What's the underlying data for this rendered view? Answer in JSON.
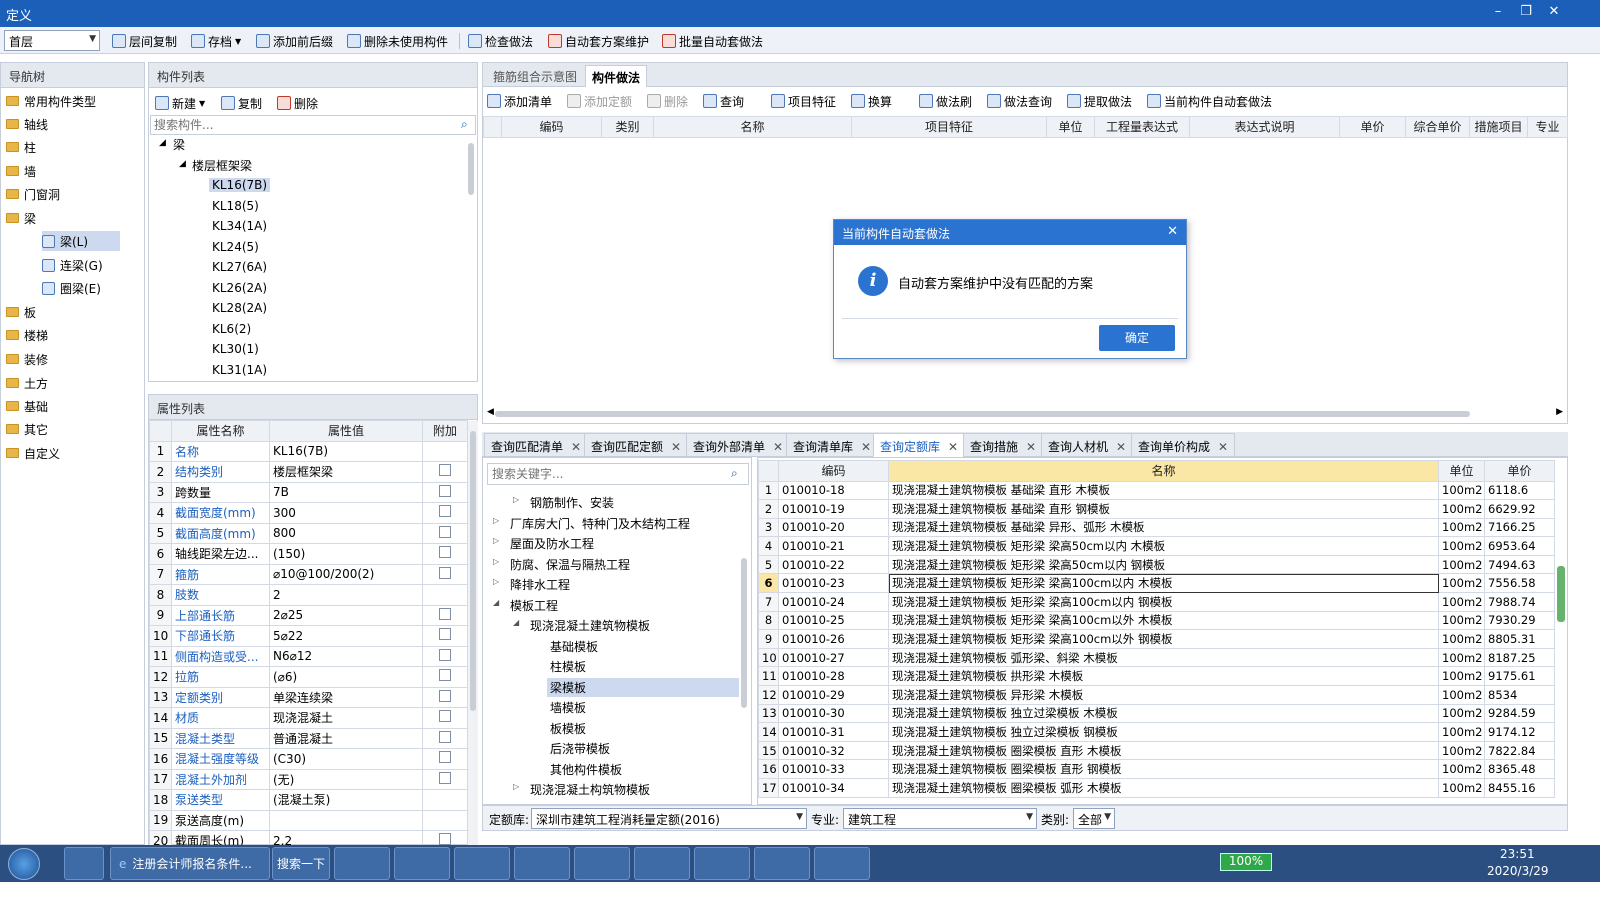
{
  "window": {
    "title": "定义",
    "min": "–",
    "restore": "❐",
    "close": "✕"
  },
  "toolbar": {
    "floor": "首层",
    "buttons": [
      "层间复制",
      "存档",
      "添加前后缀",
      "删除未使用构件",
      "检查做法",
      "自动套方案维护",
      "批量自动套做法"
    ]
  },
  "nav": {
    "title": "导航树",
    "items": [
      "常用构件类型",
      "轴线",
      "柱",
      "墙",
      "门窗洞",
      "梁",
      "梁(L)",
      "连梁(G)",
      "圈梁(E)",
      "板",
      "楼梯",
      "装修",
      "土方",
      "基础",
      "其它",
      "自定义"
    ]
  },
  "complist": {
    "title": "构件列表",
    "new": "新建",
    "copy": "复制",
    "del": "删除",
    "search_ph": "搜索构件...",
    "root": "梁",
    "group": "楼层框架梁",
    "items": [
      "KL16(7B)",
      "KL18(5)",
      "KL34(1A)",
      "KL24(5)",
      "KL27(6A)",
      "KL26(2A)",
      "KL28(2A)",
      "KL6(2)",
      "KL30(1)",
      "KL31(1A)"
    ]
  },
  "props": {
    "title": "属性列表",
    "cols": [
      "属性名称",
      "属性值",
      "附加"
    ],
    "rows": [
      [
        "1",
        "名称",
        "KL16(7B)"
      ],
      [
        "2",
        "结构类别",
        "楼层框架梁"
      ],
      [
        "3",
        "跨数量",
        "7B"
      ],
      [
        "4",
        "截面宽度(mm)",
        "300"
      ],
      [
        "5",
        "截面高度(mm)",
        "800"
      ],
      [
        "6",
        "轴线距梁左边...",
        "(150)"
      ],
      [
        "7",
        "箍筋",
        "⌀10@100/200(2)"
      ],
      [
        "8",
        "肢数",
        "2"
      ],
      [
        "9",
        "上部通长筋",
        "2⌀25"
      ],
      [
        "10",
        "下部通长筋",
        "5⌀22"
      ],
      [
        "11",
        "侧面构造或受...",
        "N6⌀12"
      ],
      [
        "12",
        "拉筋",
        "(⌀6)"
      ],
      [
        "13",
        "定额类别",
        "单梁连续梁"
      ],
      [
        "14",
        "材质",
        "现浇混凝土"
      ],
      [
        "15",
        "混凝土类型",
        "普通混凝土"
      ],
      [
        "16",
        "混凝土强度等级",
        "(C30)"
      ],
      [
        "17",
        "混凝土外加剂",
        "(无)"
      ],
      [
        "18",
        "泵送类型",
        "(混凝土泵)"
      ],
      [
        "19",
        "泵送高度(m)",
        ""
      ],
      [
        "20",
        "截面周长(m)",
        "2.2"
      ]
    ]
  },
  "tabs_top": [
    "箍筋组合示意图",
    "构件做法"
  ],
  "method_toolbar": [
    "添加清单",
    "添加定额",
    "删除",
    "查询",
    "项目特征",
    "换算",
    "做法刷",
    "做法查询",
    "提取做法",
    "当前构件自动套做法"
  ],
  "method_cols": [
    "编码",
    "类别",
    "名称",
    "项目特征",
    "单位",
    "工程量表达式",
    "表达式说明",
    "单价",
    "综合单价",
    "措施项目",
    "专业"
  ],
  "dialog": {
    "title": "当前构件自动套做法",
    "message": "自动套方案维护中没有匹配的方案",
    "ok": "确定",
    "icon": "i"
  },
  "bottom_tabs": [
    "查询匹配清单",
    "查询匹配定额",
    "查询外部清单",
    "查询清单库",
    "查询定额库",
    "查询措施",
    "查询人材机",
    "查询单价构成"
  ],
  "quota_search_ph": "搜索关键字...",
  "quota_tree": [
    "钢筋制作、安装",
    "厂库房大门、特种门及木结构工程",
    "屋面及防水工程",
    "防腐、保温与隔热工程",
    "降排水工程",
    "模板工程",
    "现浇混凝土建筑物模板",
    "基础模板",
    "柱模板",
    "梁模板",
    "墙模板",
    "板模板",
    "后浇带模板",
    "其他构件模板",
    "现浇混凝土构筑物模板"
  ],
  "quota_cols": [
    "编码",
    "名称",
    "单位",
    "单价"
  ],
  "quota_rows": [
    [
      "1",
      "010010-18",
      "现浇混凝土建筑物模板 基础梁 直形 木模板",
      "100m2",
      "6118.6"
    ],
    [
      "2",
      "010010-19",
      "现浇混凝土建筑物模板 基础梁 直形 钢模板",
      "100m2",
      "6629.92"
    ],
    [
      "3",
      "010010-20",
      "现浇混凝土建筑物模板 基础梁 异形、弧形 木模板",
      "100m2",
      "7166.25"
    ],
    [
      "4",
      "010010-21",
      "现浇混凝土建筑物模板 矩形梁 梁高50cm以内 木模板",
      "100m2",
      "6953.64"
    ],
    [
      "5",
      "010010-22",
      "现浇混凝土建筑物模板 矩形梁 梁高50cm以内 钢模板",
      "100m2",
      "7494.63"
    ],
    [
      "6",
      "010010-23",
      "现浇混凝土建筑物模板 矩形梁 梁高100cm以内 木模板",
      "100m2",
      "7556.58"
    ],
    [
      "7",
      "010010-24",
      "现浇混凝土建筑物模板 矩形梁 梁高100cm以内 钢模板",
      "100m2",
      "7988.74"
    ],
    [
      "8",
      "010010-25",
      "现浇混凝土建筑物模板 矩形梁 梁高100cm以外 木模板",
      "100m2",
      "7930.29"
    ],
    [
      "9",
      "010010-26",
      "现浇混凝土建筑物模板 矩形梁 梁高100cm以外 钢模板",
      "100m2",
      "8805.31"
    ],
    [
      "10",
      "010010-27",
      "现浇混凝土建筑物模板 弧形梁、斜梁 木模板",
      "100m2",
      "8187.25"
    ],
    [
      "11",
      "010010-28",
      "现浇混凝土建筑物模板 拱形梁 木模板",
      "100m2",
      "9175.61"
    ],
    [
      "12",
      "010010-29",
      "现浇混凝土建筑物模板 异形梁 木模板",
      "100m2",
      "8534"
    ],
    [
      "13",
      "010010-30",
      "现浇混凝土建筑物模板 独立过梁模板 木模板",
      "100m2",
      "9284.59"
    ],
    [
      "14",
      "010010-31",
      "现浇混凝土建筑物模板 独立过梁模板 钢模板",
      "100m2",
      "9174.12"
    ],
    [
      "15",
      "010010-32",
      "现浇混凝土建筑物模板 圈梁模板 直形 木模板",
      "100m2",
      "7822.84"
    ],
    [
      "16",
      "010010-33",
      "现浇混凝土建筑物模板 圈梁模板 直形 钢模板",
      "100m2",
      "8365.48"
    ],
    [
      "17",
      "010010-34",
      "现浇混凝土建筑物模板 圈梁模板 弧形 木模板",
      "100m2",
      "8455.16"
    ]
  ],
  "footer": {
    "lib_label": "定额库:",
    "lib": "深圳市建筑工程消耗量定额(2016)",
    "spec_label": "专业:",
    "spec": "建筑工程",
    "cat_label": "类别:",
    "cat": "全部"
  },
  "taskbar": {
    "app1": "注册会计师报名条件...",
    "app2": "搜索一下",
    "battery": "100%",
    "time": "23:51",
    "date": "2020/3/29"
  }
}
